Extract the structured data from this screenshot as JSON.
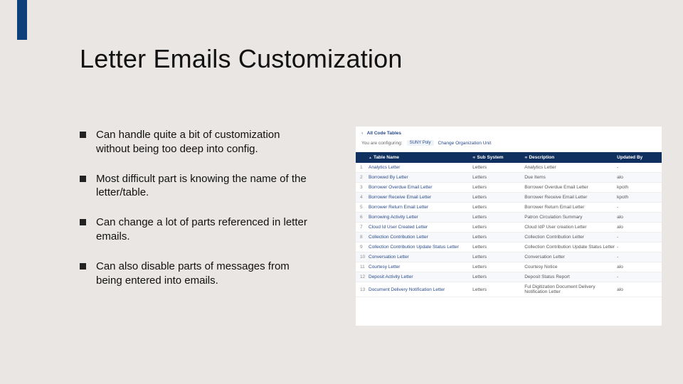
{
  "title": "Letter Emails Customization",
  "bullets": [
    "Can handle quite a bit of customization without being too deep into config.",
    "Most difficult part is knowing the name of the letter/table.",
    "Can change a lot of parts referenced in letter emails.",
    "Can also disable parts of messages from being entered into emails."
  ],
  "screenshot": {
    "back_label": "All Code Tables",
    "configuring_label": "You are configuring:",
    "pill_left": "SUNY Poly",
    "pill_link": "Change Organization Unit",
    "headers": {
      "c2": "Table Name",
      "c3": "Sub System",
      "c4": "Description",
      "c5": "Updated By"
    },
    "rows": [
      {
        "n": "1",
        "name": "Analytics Letter",
        "sub": "Letters",
        "desc": "Analytics Letter",
        "by": "-"
      },
      {
        "n": "2",
        "name": "Borrowed By Letter",
        "sub": "Letters",
        "desc": "Due Items",
        "by": "alo"
      },
      {
        "n": "3",
        "name": "Borrower Overdue Email Letter",
        "sub": "Letters",
        "desc": "Borrower Overdue Email Letter",
        "by": "kpoth"
      },
      {
        "n": "4",
        "name": "Borrower Receive Email Letter",
        "sub": "Letters",
        "desc": "Borrower Receive Email Letter",
        "by": "kpoth"
      },
      {
        "n": "5",
        "name": "Borrower Return Email Letter",
        "sub": "Letters",
        "desc": "Borrower Return Email Letter",
        "by": "-"
      },
      {
        "n": "6",
        "name": "Borrowing Activity Letter",
        "sub": "Letters",
        "desc": "Patron Circulation Summary",
        "by": "alo"
      },
      {
        "n": "7",
        "name": "Cloud Id User Created Letter",
        "sub": "Letters",
        "desc": "Cloud IdP User creation Letter",
        "by": "alo"
      },
      {
        "n": "8",
        "name": "Collection Contribution Letter",
        "sub": "Letters",
        "desc": "Collection Contribution Letter",
        "by": "-"
      },
      {
        "n": "9",
        "name": "Collection Contribution Update Status Letter",
        "sub": "Letters",
        "desc": "Collection Contribution Update Status Letter",
        "by": "-"
      },
      {
        "n": "10",
        "name": "Conversation Letter",
        "sub": "Letters",
        "desc": "Conversation Letter",
        "by": "-"
      },
      {
        "n": "11",
        "name": "Courtesy Letter",
        "sub": "Letters",
        "desc": "Courtesy Notice",
        "by": "alo"
      },
      {
        "n": "12",
        "name": "Deposit Activity Letter",
        "sub": "Letters",
        "desc": "Deposit Status Report",
        "by": "-"
      },
      {
        "n": "13",
        "name": "Document Delivery Notification Letter",
        "sub": "Letters",
        "desc": "Ful Digitization Document Delivery Notification Letter",
        "by": "alo"
      }
    ]
  }
}
